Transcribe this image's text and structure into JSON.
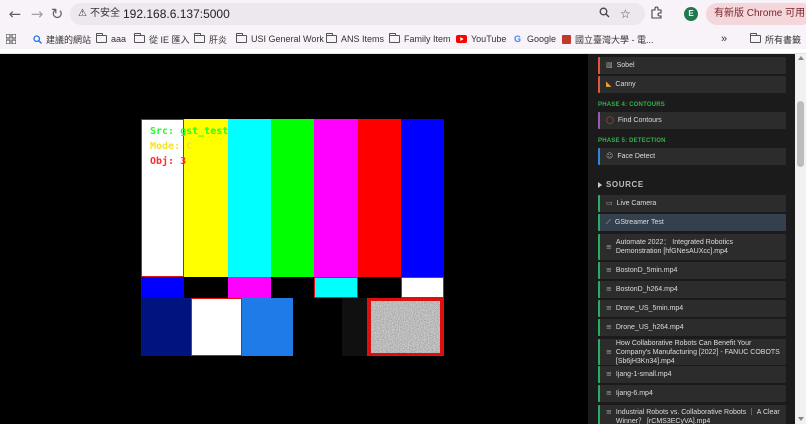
{
  "browser": {
    "back_glyph": "←",
    "forward_glyph": "→",
    "reload_glyph": "↻",
    "security_label": "不安全",
    "url": "192.168.6.137:5000",
    "zoom_icon": "🔍",
    "star_icon": "☆",
    "extensions_icon": "⧉",
    "profile_initial": "E",
    "update_label": "有新版 Chrome 可用",
    "menu_glyph": "⋮"
  },
  "bookmarks": {
    "items": [
      {
        "label": "建議的網站",
        "icon": "search-icon"
      },
      {
        "label": "aaa",
        "icon": "folder-icon"
      },
      {
        "label": "從 IE 匯入",
        "icon": "folder-icon"
      },
      {
        "label": "肝炎",
        "icon": "folder-icon"
      },
      {
        "label": "USI General Work",
        "icon": "folder-icon"
      },
      {
        "label": "ANS Items",
        "icon": "folder-icon"
      },
      {
        "label": "Family Item",
        "icon": "folder-icon"
      },
      {
        "label": "YouTube",
        "icon": "youtube-icon"
      },
      {
        "label": "Google",
        "icon": "google-icon"
      },
      {
        "label": "國立臺灣大學 - 電...",
        "icon": "ntu-icon"
      }
    ],
    "more_glyph": "»",
    "all_bookmarks_label": "所有書籤"
  },
  "video": {
    "overlay": {
      "source_line": "Src: gst_test",
      "mode_line": "Mode: C",
      "obj_line": "Obj: 3"
    },
    "colors": {
      "source": "#22ff22",
      "mode": "#f2e32a",
      "obj": "#ff2a2a"
    }
  },
  "sidebar": {
    "top_buttons": [
      {
        "label": "Sobel",
        "icon": "sobel-icon"
      },
      {
        "label": "Canny",
        "icon": "canny-icon"
      }
    ],
    "phase4": {
      "title": "PHASE 4: CONTOURS",
      "button": "Find Contours"
    },
    "phase5": {
      "title": "PHASE 5: DETECTION",
      "button": "Face Detect"
    },
    "source_title": "SOURCE",
    "source_items": [
      {
        "label": "Live Camera",
        "icon": "camera-icon"
      },
      {
        "label": "GStreamer Test",
        "icon": "wand-icon"
      },
      {
        "label": "Automate 2022： Integrated Robotics Demonstration [hfGNesAUXcc].mp4",
        "icon": "video-file-icon"
      },
      {
        "label": "BostonD_5min.mp4",
        "icon": "video-file-icon"
      },
      {
        "label": "BostonD_h264.mp4",
        "icon": "video-file-icon"
      },
      {
        "label": "Drone_US_5min.mp4",
        "icon": "video-file-icon"
      },
      {
        "label": "Drone_US_h264.mp4",
        "icon": "video-file-icon"
      },
      {
        "label": "How Collaborative Robots Can Benefit Your Company's Manufacturing [2022] - FANUC COBOTS [Sb6jH3Kn34].mp4",
        "icon": "video-file-icon"
      },
      {
        "label": "Ijang-1-small.mp4",
        "icon": "video-file-icon"
      },
      {
        "label": "Ijang-6.mp4",
        "icon": "video-file-icon"
      },
      {
        "label": "Industrial Robots vs. Collaborative Robots ｜ A Clear Winner？ [rCMS3ECyVA].mp4",
        "icon": "video-file-icon"
      }
    ],
    "accent_colors": {
      "phase": "#33b24c",
      "button_edge": "#e0573a",
      "contours_edge": "#9b59b6",
      "detection_edge": "#2e86de",
      "source_edge": "#27ae60"
    }
  }
}
